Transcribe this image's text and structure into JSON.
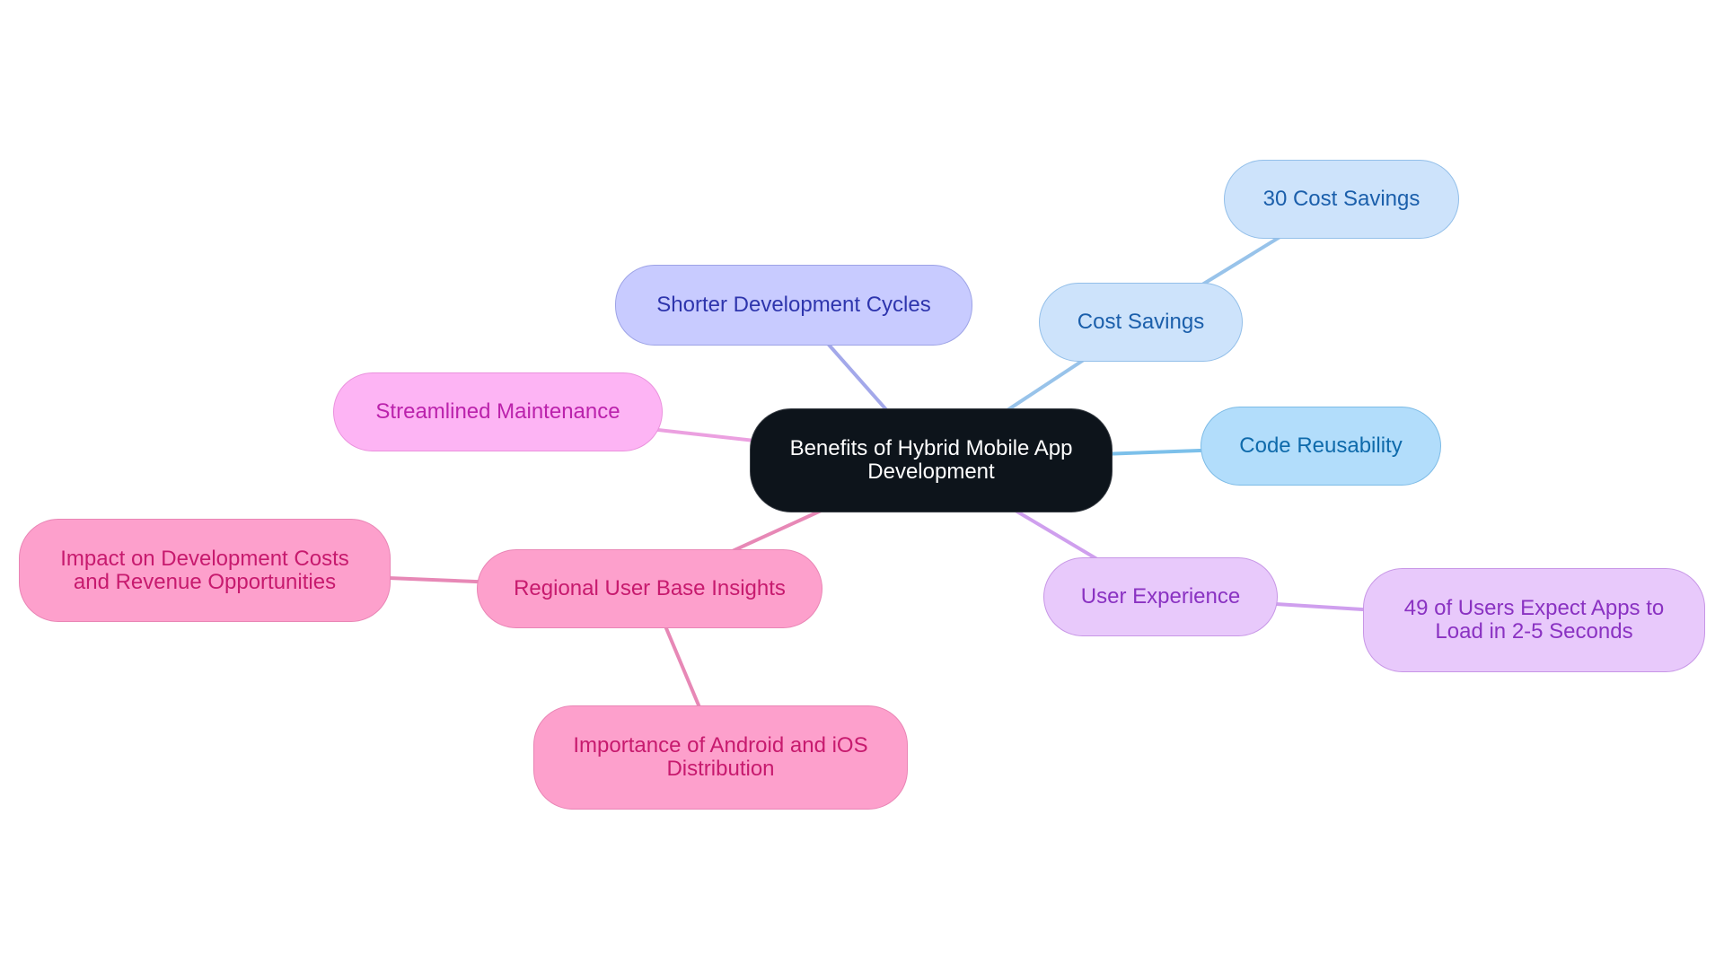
{
  "diagram": {
    "type": "mindmap",
    "root": {
      "id": "center",
      "lines": [
        "Benefits of Hybrid Mobile App",
        "Development"
      ]
    },
    "nodes": {
      "shorter": {
        "lines": [
          "Shorter Development Cycles"
        ],
        "parent": "center",
        "edge_color": "#a3a8ea"
      },
      "cost": {
        "lines": [
          "Cost Savings"
        ],
        "parent": "center",
        "edge_color": "#98c3ea"
      },
      "cost30": {
        "lines": [
          "30 Cost Savings"
        ],
        "parent": "cost",
        "edge_color": "#98c3ea"
      },
      "code": {
        "lines": [
          "Code Reusability"
        ],
        "parent": "center",
        "edge_color": "#7cc0ea"
      },
      "ux": {
        "lines": [
          "User Experience"
        ],
        "parent": "center",
        "edge_color": "#cf9fee"
      },
      "ux49": {
        "lines": [
          "49 of Users Expect Apps to",
          "Load in 2-5 Seconds"
        ],
        "parent": "ux",
        "edge_color": "#cf9fee"
      },
      "stream": {
        "lines": [
          "Streamlined Maintenance"
        ],
        "parent": "center",
        "edge_color": "#eba0e0"
      },
      "regional": {
        "lines": [
          "Regional User Base Insights"
        ],
        "parent": "center",
        "edge_color": "#e788b6"
      },
      "impact": {
        "lines": [
          "Impact on Development Costs",
          "and Revenue Opportunities"
        ],
        "parent": "regional",
        "edge_color": "#e788b6"
      },
      "android": {
        "lines": [
          "Importance of Android and iOS",
          "Distribution"
        ],
        "parent": "regional",
        "edge_color": "#e788b6"
      }
    },
    "colors": {
      "root_fill": "#0d141b",
      "root_text": "#ffffff",
      "indigo_fill": "#c8cbff",
      "blue_fill": "#cde3fb",
      "sky_fill": "#b2ddfb",
      "purple_fill": "#e8c9fb",
      "magenta_fill": "#fdb4f4",
      "pink_fill": "#fda0cc"
    }
  }
}
